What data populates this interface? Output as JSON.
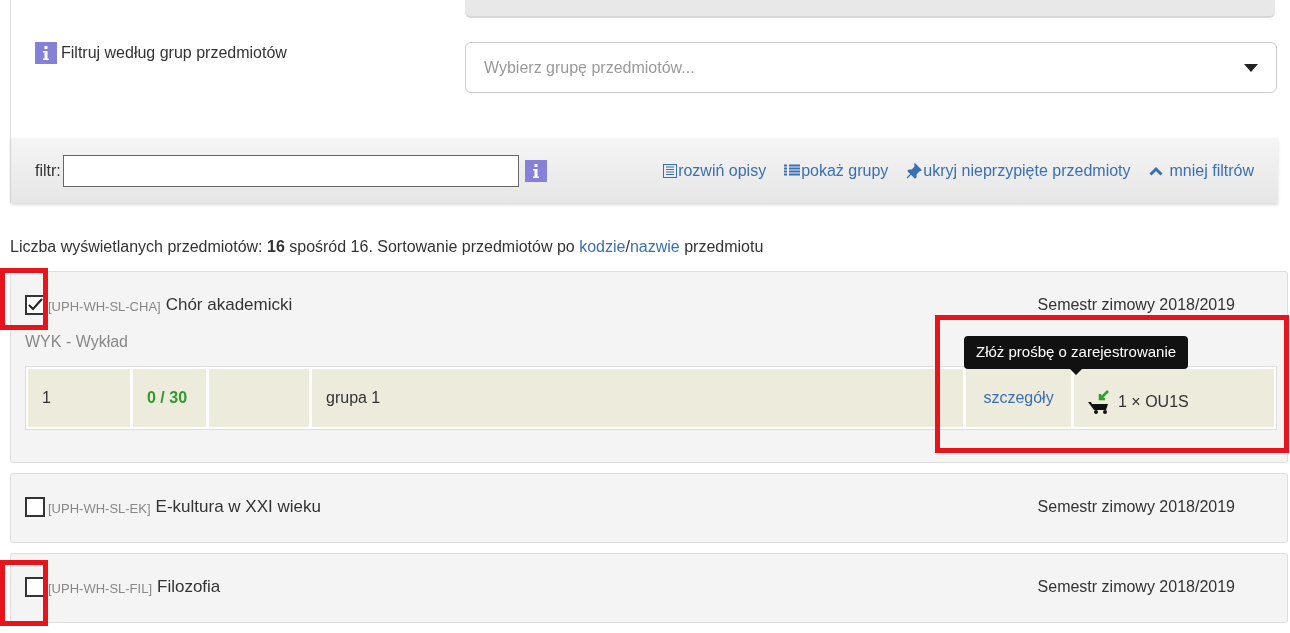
{
  "group_filter": {
    "label": "Filtruj według grup przedmiotów",
    "placeholder": "Wybierz grupę przedmiotów..."
  },
  "filter_bar": {
    "label": "filtr:",
    "links": [
      {
        "kind": "describe",
        "label": "rozwiń opisy"
      },
      {
        "kind": "list",
        "label": "pokaż grupy"
      },
      {
        "kind": "pin",
        "label": "ukryj nieprzypięte przedmioty"
      },
      {
        "kind": "collapse",
        "label": "mniej filtrów"
      }
    ]
  },
  "summary": {
    "prefix": "Liczba wyświetlanych przedmiotów: **16** spośród 16. Sortowanie przedmiotów po",
    "link_code": "kodzie",
    "separator": "/",
    "link_name": "nazwie",
    "suffix": "przedmiotu"
  },
  "courses": [
    {
      "checked": true,
      "code": "[UPH-WH-SL-CHA]",
      "name": "Chór akademicki",
      "semester": "Semestr zimowy 2018/2019",
      "expanded": true,
      "class_type": "WYK - Wykład",
      "groups": [
        {
          "number": "1",
          "seats": "0 / 30",
          "group_name": "grupa 1",
          "details": "szczegóły",
          "register": "1 × OU1S",
          "tooltip": "Złóż prośbę o zarejestrowanie"
        }
      ]
    },
    {
      "checked": false,
      "code": "[UPH-WH-SL-EK]",
      "name": "E-kultura w XXI wieku",
      "semester": "Semestr zimowy 2018/2019",
      "expanded": false
    },
    {
      "checked": false,
      "code": "[UPH-WH-SL-FIL]",
      "name": "Filozofia",
      "semester": "Semestr zimowy 2018/2019",
      "expanded": false
    }
  ]
}
